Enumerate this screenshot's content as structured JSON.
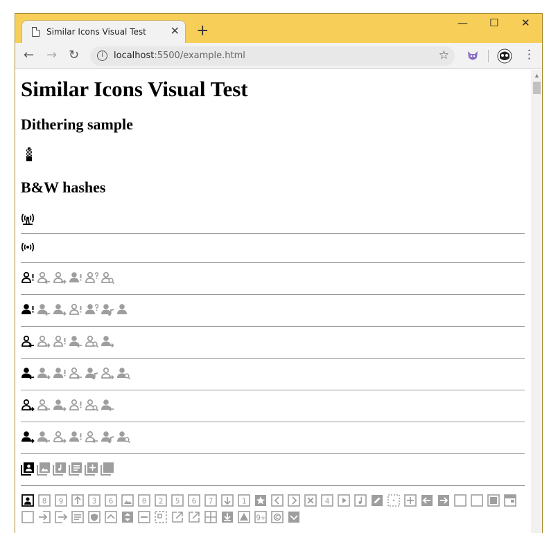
{
  "browser": {
    "tab_title": "Similar Icons Visual Test",
    "url_host": "localhost",
    "url_rest": ":5500/example.html",
    "info_glyph": "i",
    "close_glyph": "✕",
    "newtab_glyph": "+",
    "minimize_glyph": "—",
    "maximize_glyph": "☐",
    "window_close_glyph": "✕",
    "back_glyph": "←",
    "forward_glyph": "→",
    "reload_glyph": "↻",
    "star_glyph": "☆",
    "menu_glyph": "⋮"
  },
  "page": {
    "title": "Similar Icons Visual Test",
    "dither_heading": "Dithering sample",
    "bw_heading": "B&W hashes"
  },
  "colors": {
    "titlebar": "#f7cf58",
    "icon_primary": "#000000",
    "icon_similar": "#9e9e9e"
  },
  "rows": [
    {
      "primary": "podcast-tower-icon",
      "similar": []
    },
    {
      "primary": "broadcast-icon",
      "similar": []
    },
    {
      "primary": "person-alert-outline-icon",
      "similar": [
        "person-arrow-left-outline-icon",
        "person-arrow-right-outline-icon",
        "person-alert-icon",
        "person-question-outline-icon",
        "person-search-outline-icon"
      ]
    },
    {
      "primary": "person-alert-icon",
      "similar": [
        "person-arrow-left-icon",
        "person-arrow-right-icon",
        "person-alert-outline-icon",
        "person-question-icon",
        "person-music-icon",
        "person-icon"
      ]
    },
    {
      "primary": "person-arrow-left-outline-icon",
      "similar": [
        "person-arrow-right-outline-icon",
        "person-alert-outline-icon",
        "person-arrow-left-icon",
        "person-search-outline-icon",
        "person-arrow-right-icon"
      ]
    },
    {
      "primary": "person-arrow-left-icon",
      "similar": [
        "person-arrow-right-icon",
        "person-alert-icon",
        "person-arrow-left-outline-icon",
        "person-music-icon",
        "person-arrow-right-outline-icon",
        "person-search-icon"
      ]
    },
    {
      "primary": "person-arrow-right-outline-icon",
      "similar": [
        "person-arrow-left-outline-icon",
        "person-arrow-right-icon",
        "person-alert-outline-icon",
        "person-search-outline-icon",
        "person-arrow-left-icon"
      ]
    },
    {
      "primary": "person-arrow-right-icon",
      "similar": [
        "person-arrow-left-icon",
        "person-arrow-right-outline-icon",
        "person-alert-icon",
        "person-arrow-left-outline-icon",
        "person-music-icon",
        "person-search-icon"
      ]
    },
    {
      "primary": "account-box-multiple-icon",
      "similar": [
        "image-multiple-icon",
        "music-box-multiple-icon",
        "text-box-multiple-icon",
        "plus-box-multiple-icon",
        "checkbox-multiple-blank-icon"
      ]
    }
  ],
  "grid_icons": [
    "account-box-icon",
    "numeric-8-box-icon",
    "numeric-9-box-icon",
    "arrow-up-box-icon",
    "numeric-3-box-icon",
    "numeric-6-box-icon",
    "image-box-icon",
    "numeric-0-box-icon",
    "numeric-2-box-icon",
    "numeric-5-box-icon",
    "numeric-6-box-alt-icon",
    "numeric-7-box-icon",
    "arrow-down-box-icon",
    "numeric-1-box-icon",
    "star-box-icon",
    "chevron-left-box-icon",
    "chevron-right-box-icon",
    "close-box-icon",
    "numeric-4-box-icon",
    "play-box-icon",
    "music-box-icon",
    "pencil-box-icon",
    "dots-box-icon",
    "plus-box-icon",
    "arrow-left-box-icon",
    "arrow-right-box-icon",
    "blank-box-icon",
    "blank-box-alt-icon",
    "stop-box-icon",
    "window-box-icon",
    "checkbox-blank-icon",
    "login-box-icon",
    "logout-box-icon",
    "text-box-icon",
    "shield-box-icon",
    "chevron-up-box-icon",
    "swap-box-icon",
    "minus-box-icon",
    "select-box-icon",
    "open-in-new-icon",
    "launch-icon",
    "grid-box-icon",
    "download-box-icon",
    "warning-box-icon",
    "numeric-9-plus-box-icon",
    "copyright-box-icon",
    "chevron-down-box-icon"
  ]
}
